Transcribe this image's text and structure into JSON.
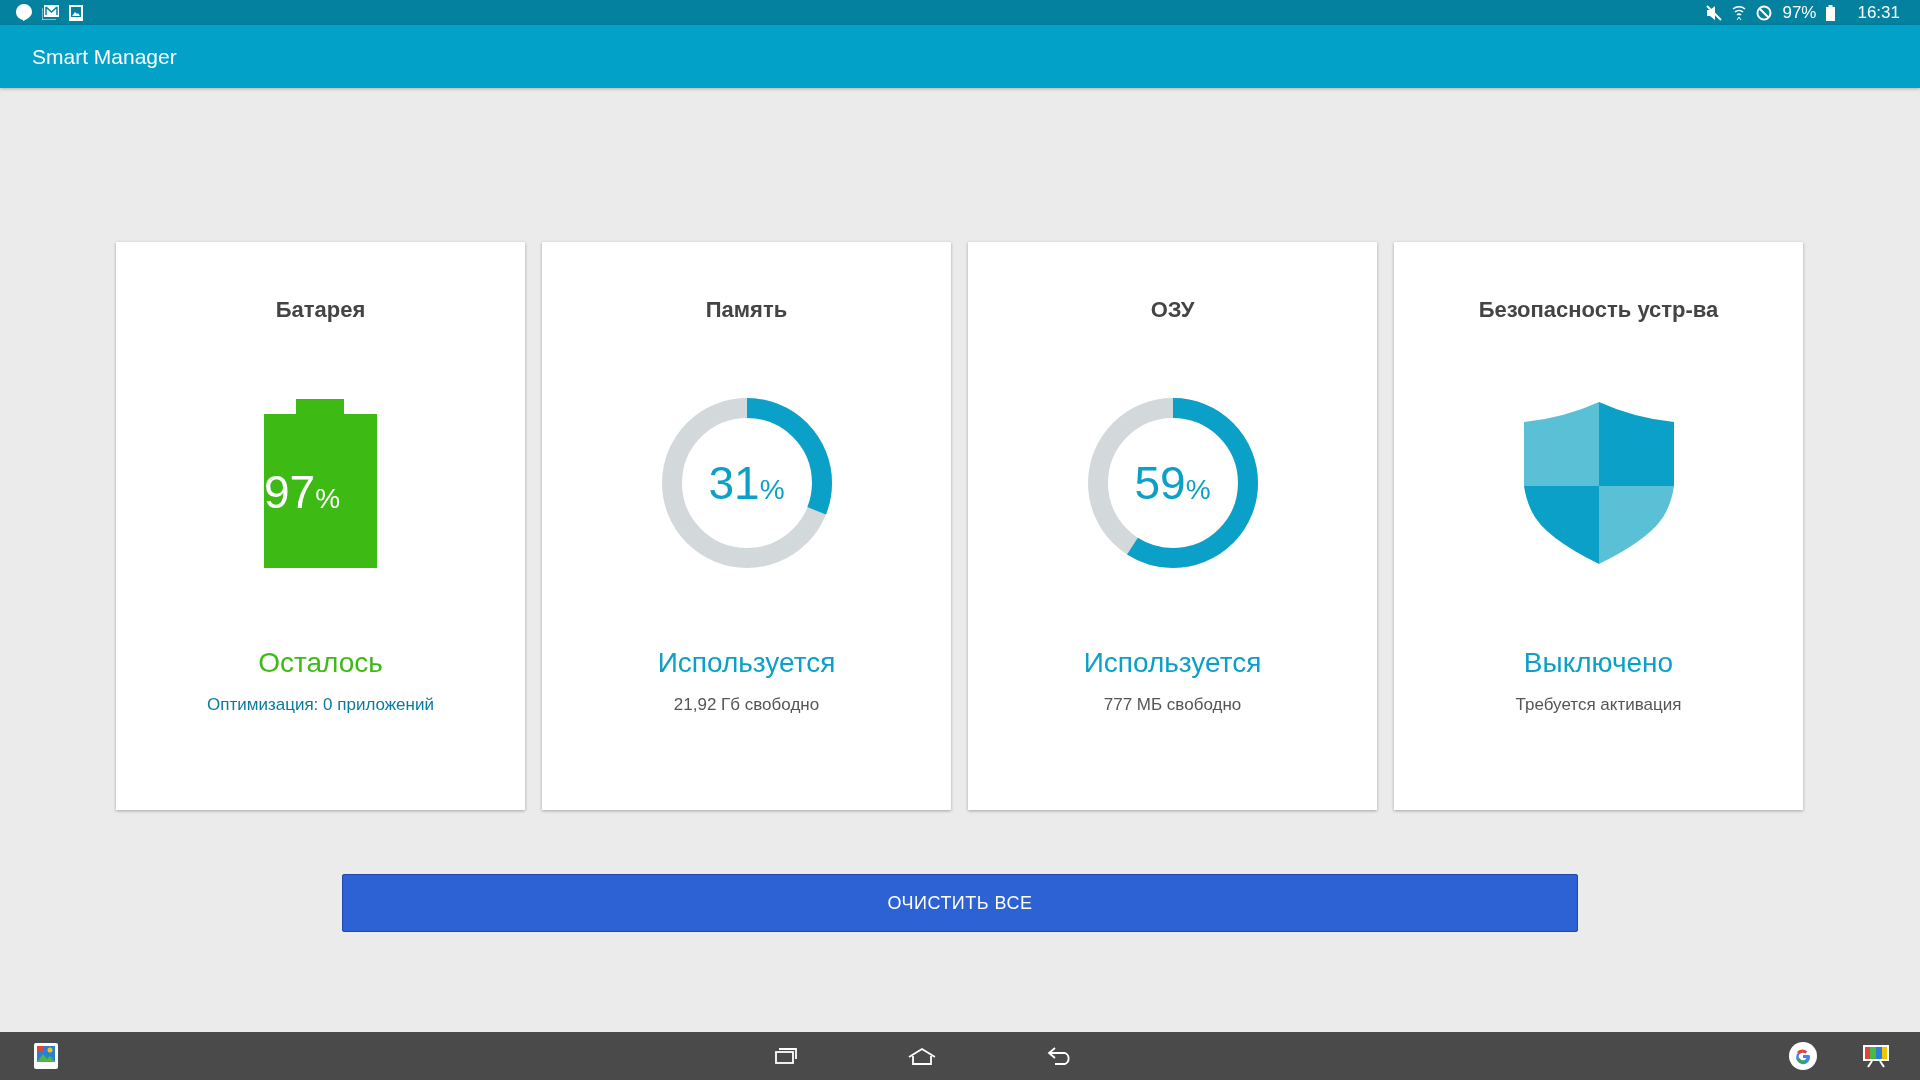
{
  "status_bar": {
    "battery": "97%",
    "time": "16:31"
  },
  "app_bar": {
    "title": "Smart Manager"
  },
  "cards": [
    {
      "kind": "battery",
      "title": "Батарея",
      "value": "97",
      "unit": "%",
      "status": "Осталось",
      "subtitle": "Оптимизация: 0 приложений",
      "color": "#3dba14"
    },
    {
      "kind": "donut",
      "title": "Память",
      "value": "31",
      "unit": "%",
      "level": 0.31,
      "status": "Используется",
      "subtitle": "21,92 Гб свободно",
      "color": "#0aa0c8"
    },
    {
      "kind": "donut",
      "title": "ОЗУ",
      "value": "59",
      "unit": "%",
      "level": 0.59,
      "status": "Используется",
      "subtitle": "777 МБ свободно",
      "color": "#0aa0c8"
    },
    {
      "kind": "shield",
      "title": "Безопасность устр-ва",
      "status": "Выключено",
      "subtitle": "Требуется активация",
      "color": "#0aa0c8"
    }
  ],
  "action_button": {
    "label": "ОЧИСТИТЬ ВСЕ"
  }
}
